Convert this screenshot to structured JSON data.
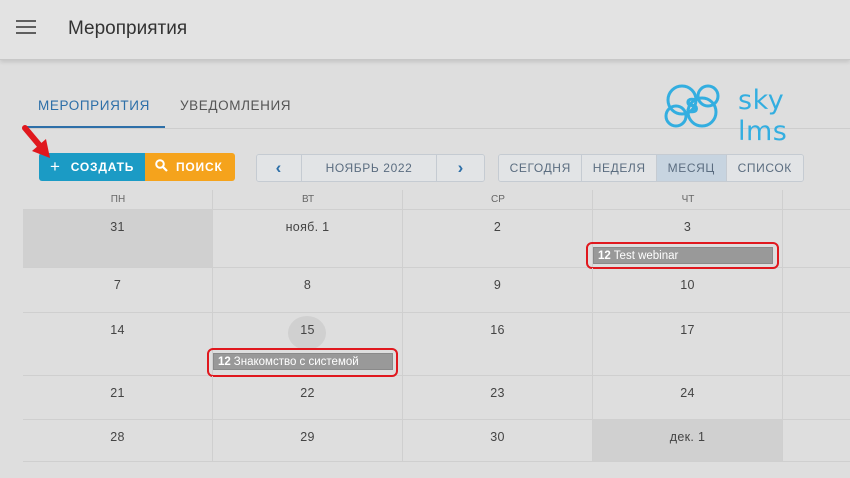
{
  "header": {
    "menu_icon": "hamburger-icon",
    "title": "Мероприятия"
  },
  "tabs": [
    {
      "label": "МЕРОПРИЯТИЯ",
      "active": true
    },
    {
      "label": "УВЕДОМЛЕНИЯ",
      "active": false
    }
  ],
  "logo": {
    "text": "sky lms",
    "icon": "sky-lms-logo"
  },
  "toolbar": {
    "create_label": "СОЗДАТЬ",
    "create_icon": "plus-icon",
    "search_label": "ПОИСК",
    "search_icon": "search-icon",
    "period_label": "НОЯБРЬ 2022",
    "prev_icon": "chevron-left-icon",
    "next_icon": "chevron-right-icon",
    "views": [
      "СЕГОДНЯ",
      "НЕДЕЛЯ",
      "МЕСЯЦ",
      "СПИСОК"
    ],
    "active_view": "МЕСЯЦ"
  },
  "calendar": {
    "weekdays": [
      "ПН",
      "ВТ",
      "СР",
      "ЧТ"
    ],
    "weeks": [
      [
        "31",
        "нояб. 1",
        "2",
        "3"
      ],
      [
        "7",
        "8",
        "9",
        "10"
      ],
      [
        "14",
        "15",
        "16",
        "17"
      ],
      [
        "21",
        "22",
        "23",
        "24"
      ],
      [
        "28",
        "29",
        "30",
        "дек. 1"
      ]
    ],
    "events": [
      {
        "time": "12",
        "title": "Test webinar"
      },
      {
        "time": "12",
        "title": "Знакомство с системой"
      }
    ]
  },
  "colors": {
    "accent": "#2d6fa8",
    "create_button": "#1b9bc5",
    "search_button": "#f5a31c",
    "highlight": "#e0181e",
    "event": "#999999"
  }
}
